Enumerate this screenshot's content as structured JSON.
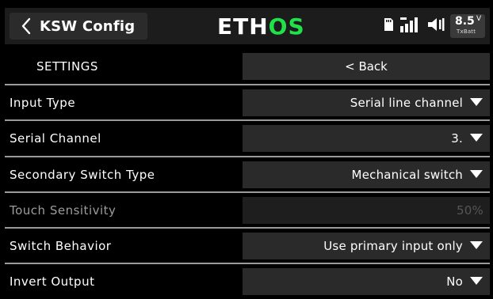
{
  "header": {
    "title": "KSW Config",
    "brand_left": "ETH",
    "brand_right": "OS",
    "battery_value": "8.5",
    "battery_unit": "V",
    "battery_label": "TxBatt",
    "icons": [
      "chevron-left-icon",
      "sd-card-icon",
      "signal-bars-icon",
      "speaker-icon"
    ]
  },
  "settings": {
    "section_label": "SETTINGS",
    "back_label": "< Back"
  },
  "rows": [
    {
      "label": "Input Type",
      "value": "Serial line channel",
      "dropdown": true
    },
    {
      "label": "Serial Channel",
      "value": "3.",
      "dropdown": true
    },
    {
      "label": "Secondary Switch Type",
      "value": "Mechanical switch",
      "dropdown": true
    },
    {
      "label": "Touch Sensitivity",
      "value": "50%",
      "dropdown": false
    },
    {
      "label": "Switch Behavior",
      "value": "Use primary input only",
      "dropdown": true
    },
    {
      "label": "Invert Output",
      "value": "No",
      "dropdown": true
    }
  ],
  "colors": {
    "accent": "#20e14a",
    "background": "#000000",
    "header": "#1c1c1c",
    "field": "#2a2a2a",
    "divider": "#9a9a9a"
  }
}
